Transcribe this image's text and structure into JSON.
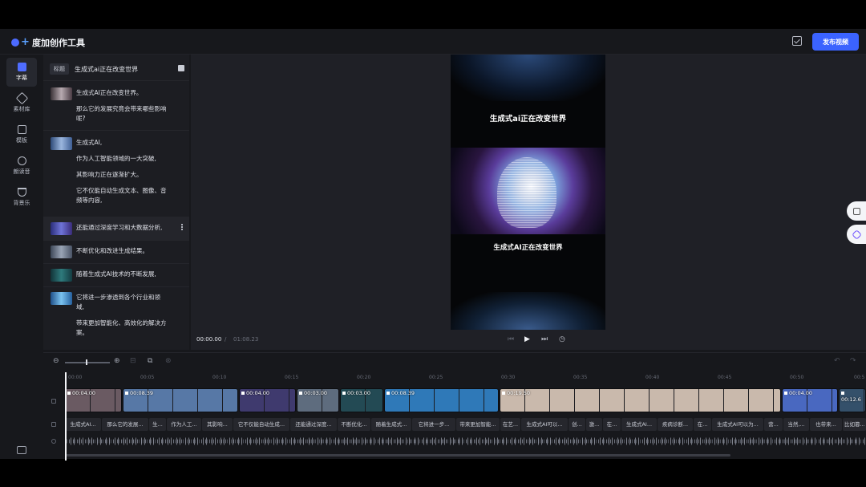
{
  "app": {
    "name": "度加创作工具",
    "publish_label": "发布视频"
  },
  "nav": [
    {
      "label": "字幕",
      "active": true
    },
    {
      "label": "素材库"
    },
    {
      "label": "模板"
    },
    {
      "label": "朗读音"
    },
    {
      "label": "背景乐"
    }
  ],
  "panel": {
    "title_tag": "标题",
    "title_text": "生成式ai正在改变世界",
    "segments": [
      {
        "lines": [
          "生成式AI正在改变世界。",
          "那么它的发展究竟会带来哪些影响",
          "呢?"
        ]
      },
      {
        "lines": [
          "生成式AI,",
          "作为人工智能领域的一大突破,",
          "其影响力正在逐渐扩大。",
          "它不仅能自动生成文本、图像、音",
          "频等内容,"
        ]
      },
      {
        "lines": [
          "还能通过深度学习和大数据分析,"
        ]
      },
      {
        "lines": [
          "不断优化和改进生成结果。"
        ]
      },
      {
        "lines": [
          "随着生成式AI技术的不断发展,"
        ]
      },
      {
        "lines": [
          "它将进一步渗透到各个行业和领",
          "域,",
          "带来更加智能化、高效化的解决方",
          "案。"
        ]
      }
    ]
  },
  "preview": {
    "title": "生成式ai正在改变世界",
    "caption": "生成式AI正在改变世界",
    "time_current": "00:00.00",
    "time_sep": "/",
    "time_total": "01:08.23"
  },
  "timeline": {
    "ticks": [
      "00:00",
      "00:05",
      "00:10",
      "00:15",
      "00:20",
      "00:25",
      "00:30",
      "00:35",
      "00:40",
      "00:45",
      "00:50",
      "00:5"
    ],
    "clips": [
      {
        "duration": "00:04.00",
        "color": "#6a5a62"
      },
      {
        "duration": "00:08.39",
        "color": "#5778a6"
      },
      {
        "duration": "00:04.00",
        "color": "#3f3a6e"
      },
      {
        "duration": "00:03.00",
        "color": "#5e6c7e"
      },
      {
        "duration": "00:03.00",
        "color": "#234a54"
      },
      {
        "duration": "00:08.39",
        "color": "#2f79b8"
      },
      {
        "duration": "00:19.50",
        "color": "#c9b9ac"
      },
      {
        "duration": "00:04.00",
        "color": "#4968c0"
      },
      {
        "duration": "00:12.6",
        "color": "#34506a"
      }
    ],
    "captions": [
      "生成式AI...",
      "那么它的发展...",
      "生...",
      "作为人工...",
      "其影响...",
      "它不仅能自动生成...",
      "还能通过深度...",
      "不断优化...",
      "随着生成式...",
      "它将进一步...",
      "带来更加智能...",
      "在艺...",
      "生成式AI可以...",
      "创...",
      "激...",
      "在...",
      "生成式AI...",
      "疾病诊断...",
      "在...",
      "生成式AI可以为...",
      "营...",
      "当然,...",
      "也带来...",
      "比如篡..."
    ]
  }
}
